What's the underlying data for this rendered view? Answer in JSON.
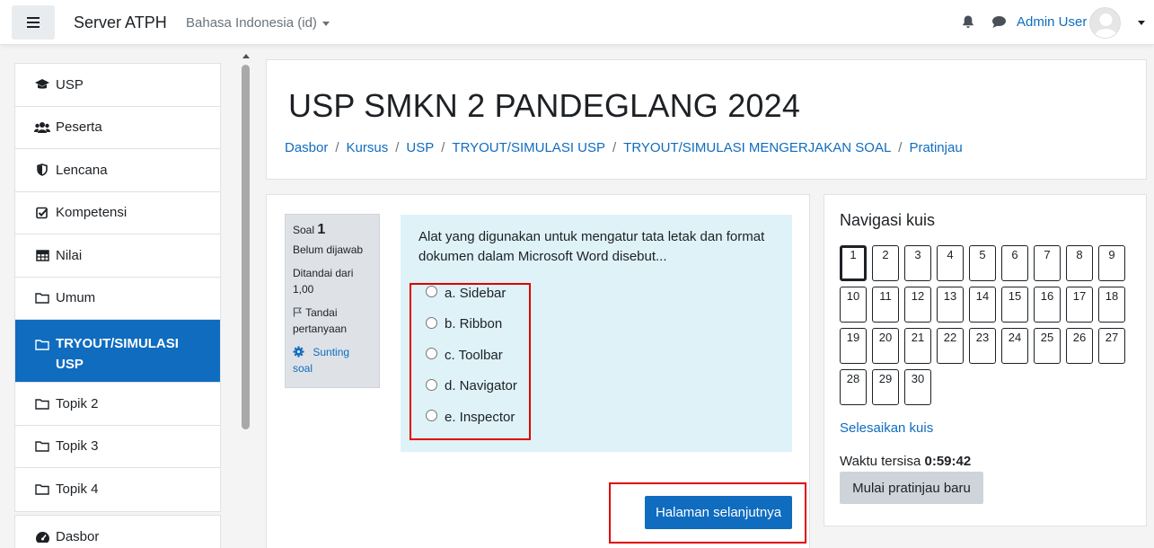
{
  "navbar": {
    "site_name": "Server ATPH",
    "language": "Bahasa Indonesia (id)",
    "user_name": "Admin User"
  },
  "drawer": {
    "items": [
      {
        "label": "USP",
        "icon": "graduation-cap-icon"
      },
      {
        "label": "Peserta",
        "icon": "users-icon"
      },
      {
        "label": "Lencana",
        "icon": "shield-icon"
      },
      {
        "label": "Kompetensi",
        "icon": "check-square-icon"
      },
      {
        "label": "Nilai",
        "icon": "table-icon"
      },
      {
        "label": "Umum",
        "icon": "folder-icon"
      },
      {
        "label": "TRYOUT/SIMULASI USP",
        "icon": "folder-icon",
        "active": true
      },
      {
        "label": "Topik 2",
        "icon": "folder-icon"
      },
      {
        "label": "Topik 3",
        "icon": "folder-icon"
      },
      {
        "label": "Topik 4",
        "icon": "folder-icon"
      }
    ],
    "dashboard": {
      "label": "Dasbor",
      "icon": "dashboard-icon"
    }
  },
  "header": {
    "title": "USP SMKN 2 PANDEGLANG 2024",
    "breadcrumb": [
      "Dasbor",
      "Kursus",
      "USP",
      "TRYOUT/SIMULASI USP",
      "TRYOUT/SIMULASI MENGERJAKAN SOAL",
      "Pratinjau"
    ]
  },
  "question": {
    "label": "Soal",
    "number": "1",
    "status": "Belum dijawab",
    "marked_out_of": "Ditandai dari 1,00",
    "flag_label": "Tandai pertanyaan",
    "edit_label": "Sunting soal",
    "text": "Alat yang digunakan untuk mengatur tata letak dan format dokumen dalam Microsoft Word disebut...",
    "options": [
      "a. Sidebar",
      "b. Ribbon",
      "c. Toolbar",
      "d. Navigator",
      "e. Inspector"
    ],
    "next_button": "Halaman selanjutnya"
  },
  "quiz_nav": {
    "title": "Navigasi kuis",
    "buttons": [
      "1",
      "2",
      "3",
      "4",
      "5",
      "6",
      "7",
      "8",
      "9",
      "10",
      "11",
      "12",
      "13",
      "14",
      "15",
      "16",
      "17",
      "18",
      "19",
      "20",
      "21",
      "22",
      "23",
      "24",
      "25",
      "26",
      "27",
      "28",
      "29",
      "30"
    ],
    "current": "1",
    "finish_label": "Selesaikan kuis",
    "time_label": "Waktu tersisa",
    "time_value": "0:59:42",
    "restart_button": "Mulai pratinjau baru"
  },
  "colors": {
    "primary": "#0f6cbf",
    "question_bg": "#def2f8",
    "highlight": "#e00000"
  }
}
